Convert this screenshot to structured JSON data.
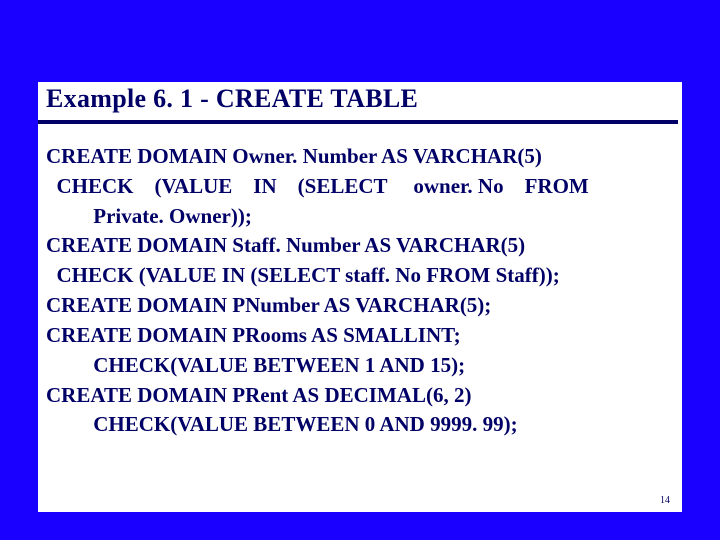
{
  "slide": {
    "title": "Example 6. 1 - CREATE TABLE",
    "lines": {
      "l1": "CREATE DOMAIN Owner. Number AS VARCHAR(5)",
      "l2": "  CHECK    (VALUE    IN    (SELECT     owner. No    FROM",
      "l3": "         Private. Owner));",
      "l4": "CREATE DOMAIN Staff. Number AS VARCHAR(5)",
      "l5": "  CHECK (VALUE IN (SELECT staff. No FROM Staff));",
      "l6": "CREATE DOMAIN PNumber AS VARCHAR(5);",
      "l7": "CREATE DOMAIN PRooms AS SMALLINT;",
      "l8": "         CHECK(VALUE BETWEEN 1 AND 15);",
      "l9": "CREATE DOMAIN PRent AS DECIMAL(6, 2)",
      "l10": "         CHECK(VALUE BETWEEN 0 AND 9999. 99);"
    },
    "page_number": "14"
  }
}
